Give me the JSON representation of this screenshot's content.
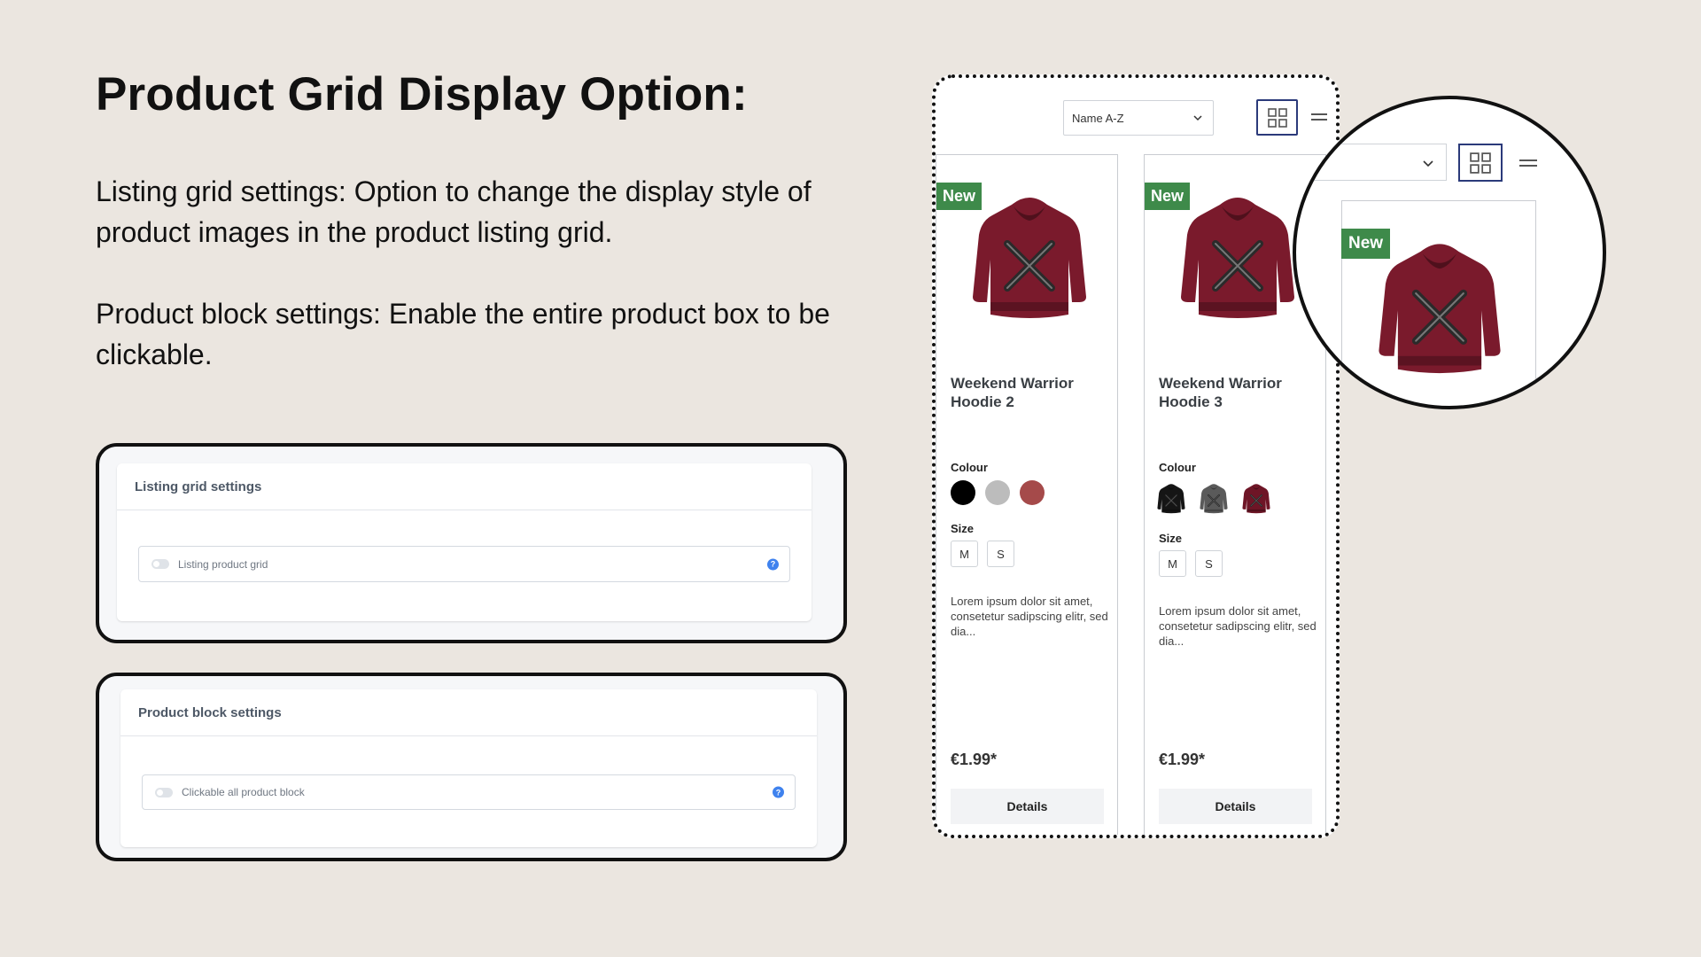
{
  "heading": "Product Grid Display Option:",
  "paragraphs": [
    "Listing grid settings: Option to change the display style of product images in the product listing grid.",
    "Product block settings: Enable the entire product box to be clickable."
  ],
  "settings_cards": [
    {
      "title": "Listing grid settings",
      "field_label": "Listing product grid",
      "help": "?"
    },
    {
      "title": "Product block settings",
      "field_label": "Clickable all product block",
      "help": "?"
    }
  ],
  "listing": {
    "sort_value": "Name A-Z",
    "products": [
      {
        "badge": "New",
        "name": "Weekend Warrior Hoodie 2",
        "colour_label": "Colour",
        "colour_display": "dots",
        "colours": [
          "#000000",
          "#bcbcbc",
          "#a54a4a"
        ],
        "size_label": "Size",
        "sizes": [
          "M",
          "S"
        ],
        "description": "Lorem ipsum dolor sit amet, consetetur sadipscing elitr, sed dia...",
        "price": "€1.99*",
        "details_label": "Details"
      },
      {
        "badge": "New",
        "name": "Weekend Warrior Hoodie 3",
        "colour_label": "Colour",
        "colour_display": "thumbnails",
        "colours": [
          "#151515",
          "#5a5a5a",
          "#6e1526"
        ],
        "size_label": "Size",
        "sizes": [
          "M",
          "S"
        ],
        "description": "Lorem ipsum dolor sit amet, consetetur sadipscing elitr, sed dia...",
        "price": "€1.99*",
        "details_label": "Details"
      }
    ]
  },
  "zoom": {
    "badge": "New"
  },
  "colors": {
    "background": "#ebe6e0",
    "badge_green": "#3e8a4a",
    "grid_button_border": "#2b3a7a",
    "help_blue": "#3f82ee",
    "hoodie": "#7a1a2c"
  }
}
